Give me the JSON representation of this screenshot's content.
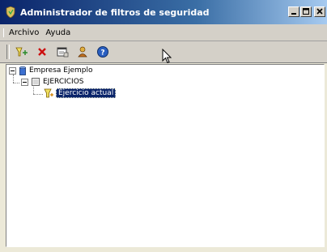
{
  "window": {
    "title": "Administrador de filtros de seguridad",
    "buttons": {
      "minimize": "_",
      "maximize": "□",
      "close": "×"
    }
  },
  "menu": [
    {
      "label": "Archivo"
    },
    {
      "label": "Ayuda"
    }
  ],
  "toolbar": [
    {
      "icon": "new-filter-icon"
    },
    {
      "icon": "delete-icon"
    },
    {
      "icon": "properties-icon"
    },
    {
      "icon": "users-icon"
    },
    {
      "icon": "help-icon"
    }
  ],
  "tree": {
    "root": {
      "label": "Empresa Ejemplo",
      "icon": "database-icon",
      "expanded": true
    },
    "group": {
      "label": "EJERCICIOS",
      "icon": "folder-icon",
      "expanded": true
    },
    "leaf": {
      "label": "Ejercicio actual",
      "icon": "filter-icon",
      "selected": true
    }
  },
  "colors": {
    "title_start": "#0a246a",
    "title_end": "#a6caf0",
    "selection": "#0a246a",
    "chrome": "#d4d0c8"
  }
}
